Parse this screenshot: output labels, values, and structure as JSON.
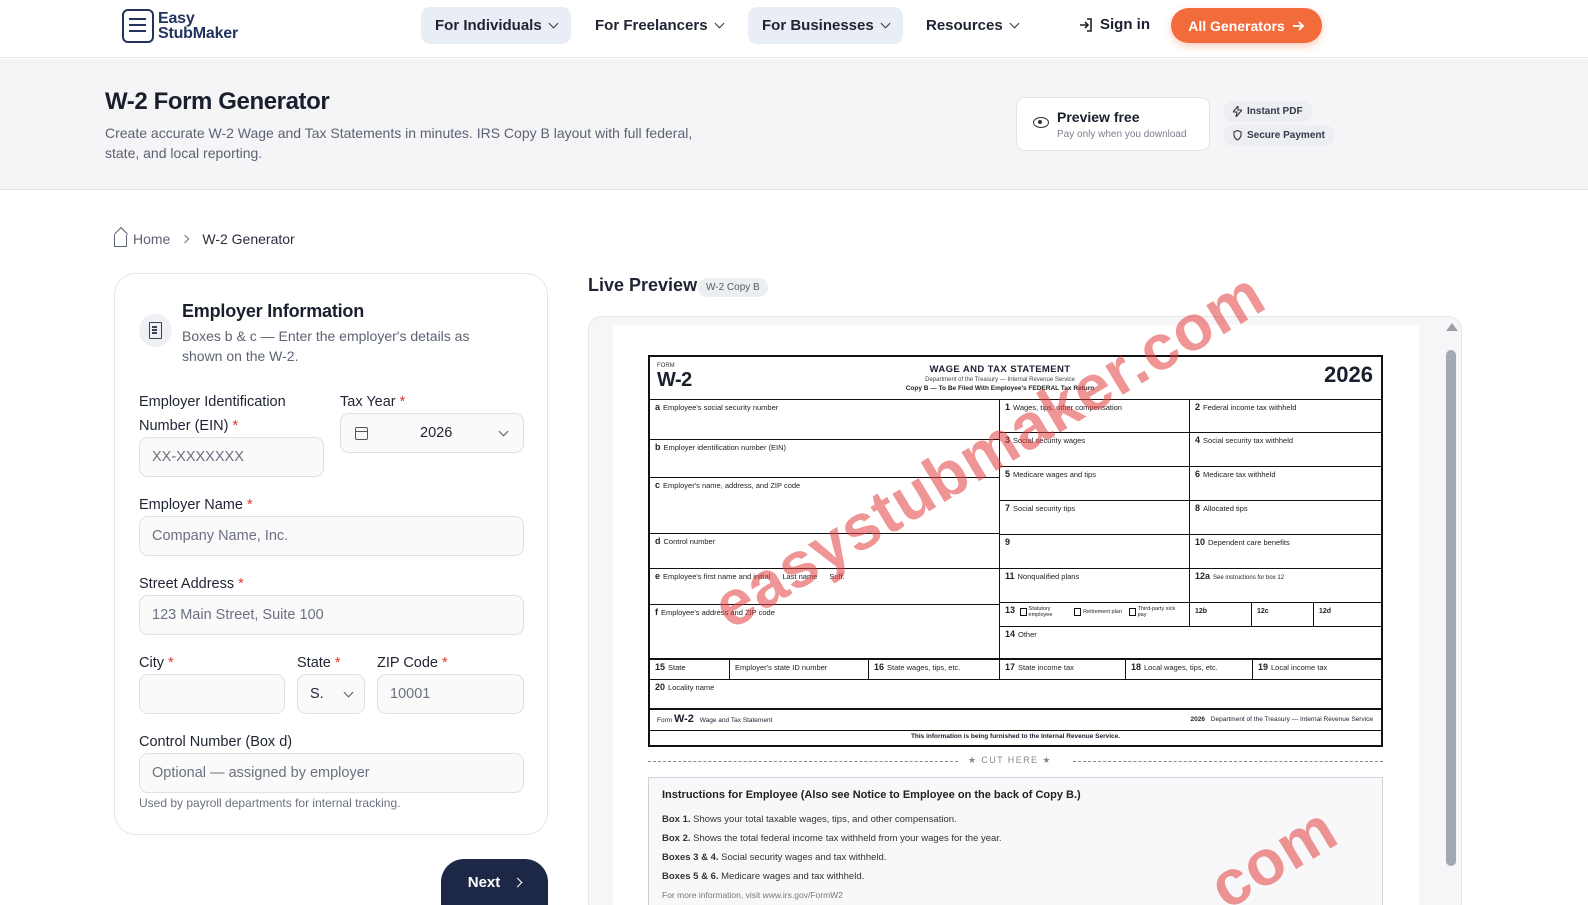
{
  "nav": {
    "logo_line1": "Easy",
    "logo_line2": "StubMaker",
    "items": [
      {
        "label": "For Individuals"
      },
      {
        "label": "For Freelancers"
      },
      {
        "label": "For Businesses"
      },
      {
        "label": "Resources"
      }
    ],
    "signin": "Sign in",
    "all_generators": "All Generators",
    "accent": "#f26b3a"
  },
  "hero": {
    "title": "W-2 Form Generator",
    "description": "Create accurate W-2 Wage and Tax Statements in minutes. IRS Copy B layout with full federal, state, and local reporting.",
    "preview_title": "Preview free",
    "preview_sub": "Pay only when you download",
    "badge_pdf": "Instant PDF",
    "badge_secure": "Secure Payment"
  },
  "breadcrumb": {
    "home": "Home",
    "current": "W-2 Generator"
  },
  "form": {
    "section_title": "Employer Information",
    "section_desc": "Boxes b & c — Enter the employer's details as shown on the W-2.",
    "ein_label": "Employer Identification Number (EIN)",
    "ein_placeholder": "XX-XXXXXXX",
    "tax_year_label": "Tax Year",
    "tax_year_value": "2026",
    "employer_name_label": "Employer Name",
    "employer_name_placeholder": "Company Name, Inc.",
    "street_label": "Street Address",
    "street_placeholder": "123 Main Street, Suite 100",
    "city_label": "City",
    "city_value": "",
    "state_label": "State",
    "state_value": "S.",
    "zip_label": "ZIP Code",
    "zip_placeholder": "10001",
    "control_label": "Control Number (Box d)",
    "control_placeholder": "Optional — assigned by employer",
    "control_hint": "Used by payroll departments for internal tracking.",
    "required_mark": "*",
    "next": "Next"
  },
  "preview": {
    "title": "Live Preview",
    "badge": "W-2 Copy B",
    "w2": {
      "form_word": "FORM",
      "form_name": "W-2",
      "head_title": "WAGE AND TAX STATEMENT",
      "head_dept": "Department of the Treasury — Internal Revenue Service",
      "head_copy": "Copy B — To Be Filed With Employee's FEDERAL Tax Return",
      "year": "2026",
      "a_num": "a",
      "a": "Employee's social security number",
      "b_num": "b",
      "b": "Employer identification number (EIN)",
      "c_num": "c",
      "c": "Employer's name, address, and ZIP code",
      "d_num": "d",
      "d": "Control number",
      "e_num": "e",
      "e": "Employee's first name and initial",
      "e_last": "Last name",
      "e_suff": "Suff.",
      "f_num": "f",
      "f": "Employee's address and ZIP code",
      "b1_num": "1",
      "b1": "Wages, tips, other compensation",
      "b2_num": "2",
      "b2": "Federal income tax withheld",
      "b3_num": "3",
      "b3": "Social security wages",
      "b4_num": "4",
      "b4": "Social security tax withheld",
      "b5_num": "5",
      "b5": "Medicare wages and tips",
      "b6_num": "6",
      "b6": "Medicare tax withheld",
      "b7_num": "7",
      "b7": "Social security tips",
      "b8_num": "8",
      "b8": "Allocated tips",
      "b9_num": "9",
      "b10_num": "10",
      "b10": "Dependent care benefits",
      "b11_num": "11",
      "b11": "Nonqualified plans",
      "b12a_num": "12a",
      "b12a": "See instructions for box 12",
      "b12b_num": "12b",
      "b12c_num": "12c",
      "b12d_num": "12d",
      "b13_num": "13",
      "b13_stat": "Statutory employee",
      "b13_ret": "Retirement plan",
      "b13_third": "Third-party sick pay",
      "b14_num": "14",
      "b14": "Other",
      "b15_num": "15",
      "b15": "State",
      "b15_id": "Employer's state ID number",
      "b16_num": "16",
      "b16": "State wages, tips, etc.",
      "b17_num": "17",
      "b17": "State income tax",
      "b18_num": "18",
      "b18": "Local wages, tips, etc.",
      "b19_num": "19",
      "b19": "Local income tax",
      "b20_num": "20",
      "b20": "Locality name",
      "foot_form": "Form",
      "foot_name": "W-2",
      "foot_stmt": "Wage and Tax Statement",
      "foot_year": "2026",
      "foot_dept": "Department of the Treasury — Internal Revenue Service",
      "foot_note": "This information is being furnished to the Internal Revenue Service."
    },
    "cut_here": "CUT HERE",
    "instructions": {
      "title": "Instructions for Employee (Also see Notice to Employee on the back of Copy B.)",
      "lines": [
        {
          "k": "Box 1.",
          "v": "Shows your total taxable wages, tips, and other compensation."
        },
        {
          "k": "Box 2.",
          "v": "Shows the total federal income tax withheld from your wages for the year."
        },
        {
          "k": "Boxes 3 & 4.",
          "v": "Social security wages and tax withheld."
        },
        {
          "k": "Boxes 5 & 6.",
          "v": "Medicare wages and tax withheld."
        }
      ],
      "more": "For more information, visit www.irs.gov/FormW2"
    },
    "watermark": "easystubmaker.com",
    "watermark2": ".com"
  }
}
